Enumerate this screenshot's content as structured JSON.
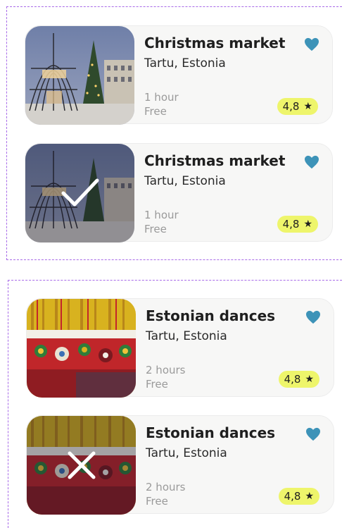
{
  "colors": {
    "accent_heart": "#3d93b8",
    "rating_bg": "#eef56b",
    "group_border": "#a86be8"
  },
  "cards": [
    {
      "title": "Christmas market",
      "location": "Tartu, Estonia",
      "duration": "1 hour",
      "price": "Free",
      "rating": "4,8",
      "image": "christmas-market-photo",
      "state": "default"
    },
    {
      "title": "Christmas market",
      "location": "Tartu, Estonia",
      "duration": "1 hour",
      "price": "Free",
      "rating": "4,8",
      "image": "christmas-market-photo",
      "state": "selected"
    },
    {
      "title": "Estonian dances",
      "location": "Tartu, Estonia",
      "duration": "2 hours",
      "price": "Free",
      "rating": "4,8",
      "image": "folk-costume-photo",
      "state": "default"
    },
    {
      "title": "Estonian dances",
      "location": "Tartu, Estonia",
      "duration": "2 hours",
      "price": "Free",
      "rating": "4,8",
      "image": "folk-costume-photo",
      "state": "rejected"
    }
  ]
}
